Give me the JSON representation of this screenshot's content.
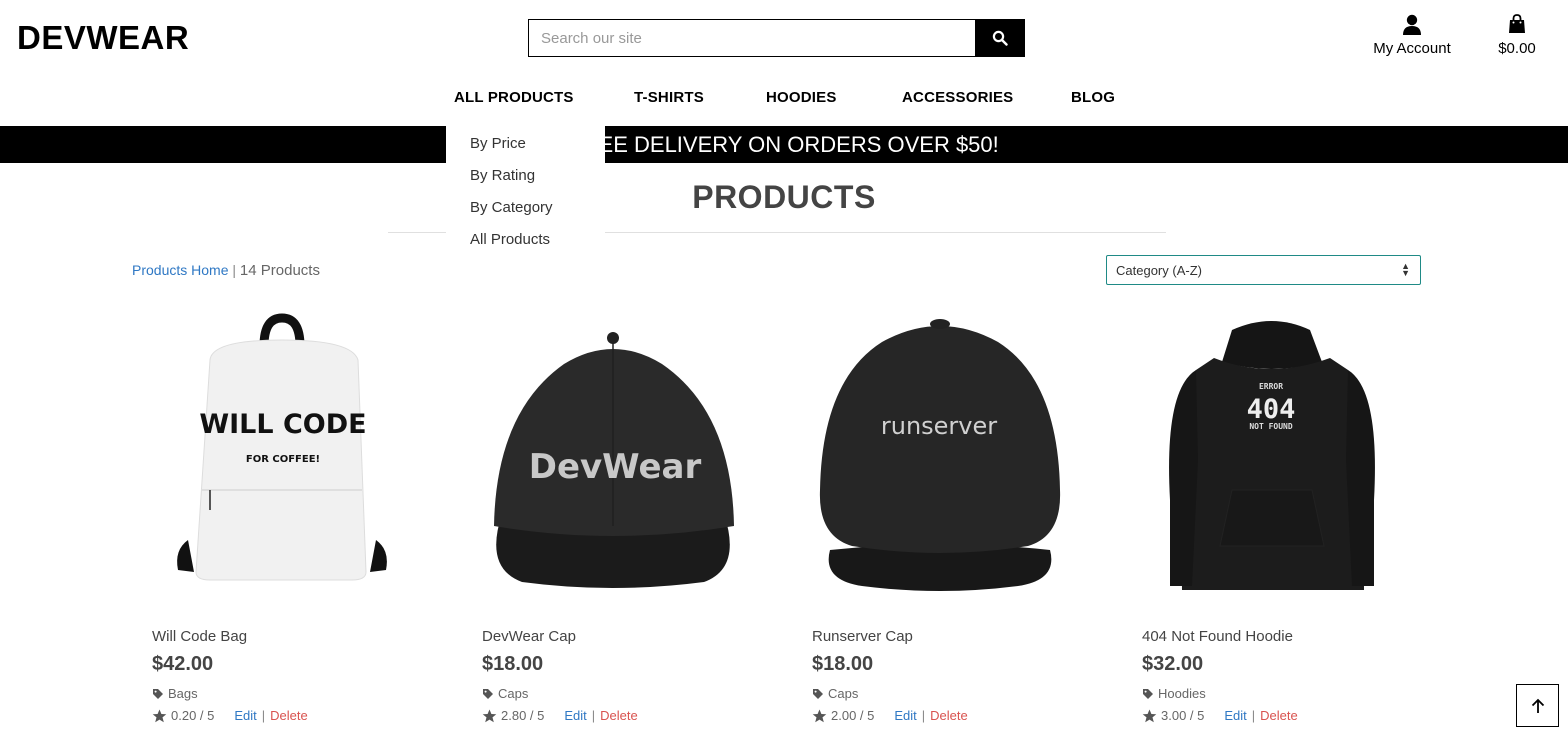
{
  "brand": {
    "name": "DEVWEAR"
  },
  "search": {
    "placeholder": "Search our site",
    "value": "",
    "icon": "search-icon"
  },
  "header": {
    "account_label": "My Account",
    "account_icon": "user-icon",
    "bag_total": "$0.00",
    "bag_icon": "shopping-bag-icon"
  },
  "nav": {
    "items": [
      {
        "label": "ALL PRODUCTS"
      },
      {
        "label": "T-SHIRTS"
      },
      {
        "label": "HOODIES"
      },
      {
        "label": "ACCESSORIES"
      },
      {
        "label": "BLOG"
      }
    ],
    "dropdown": [
      "By Price",
      "By Rating",
      "By Category",
      "All Products"
    ]
  },
  "banner": {
    "text": "FREE DELIVERY ON ORDERS OVER $50!",
    "visible_text": "E DELIVERY ON ORDERS OVER $50!"
  },
  "page": {
    "title": "PRODUCTS",
    "breadcrumb_link": "Products Home",
    "breadcrumb_sep": "|",
    "product_count": "14 Products"
  },
  "sort": {
    "selected": "Category (A-Z)"
  },
  "products": [
    {
      "name": "Will Code Bag",
      "price": "$42.00",
      "category": "Bags",
      "rating": "0.20 / 5",
      "edit": "Edit",
      "delete": "Delete",
      "image_text": [
        "WILL CODE",
        "FOR COFFEE!"
      ]
    },
    {
      "name": "DevWear Cap",
      "price": "$18.00",
      "category": "Caps",
      "rating": "2.80 / 5",
      "edit": "Edit",
      "delete": "Delete",
      "image_text": [
        "DevWear"
      ]
    },
    {
      "name": "Runserver Cap",
      "price": "$18.00",
      "category": "Caps",
      "rating": "2.00 / 5",
      "edit": "Edit",
      "delete": "Delete",
      "image_text": [
        "runserver"
      ]
    },
    {
      "name": "404 Not Found Hoodie",
      "price": "$32.00",
      "category": "Hoodies",
      "rating": "3.00 / 5",
      "edit": "Edit",
      "delete": "Delete",
      "image_text": [
        "ERROR",
        "404",
        "NOT FOUND"
      ]
    }
  ],
  "colors": {
    "link": "#2f78c4",
    "danger": "#d9534f",
    "accent": "#1f8a86",
    "banner_bg": "#000000"
  }
}
